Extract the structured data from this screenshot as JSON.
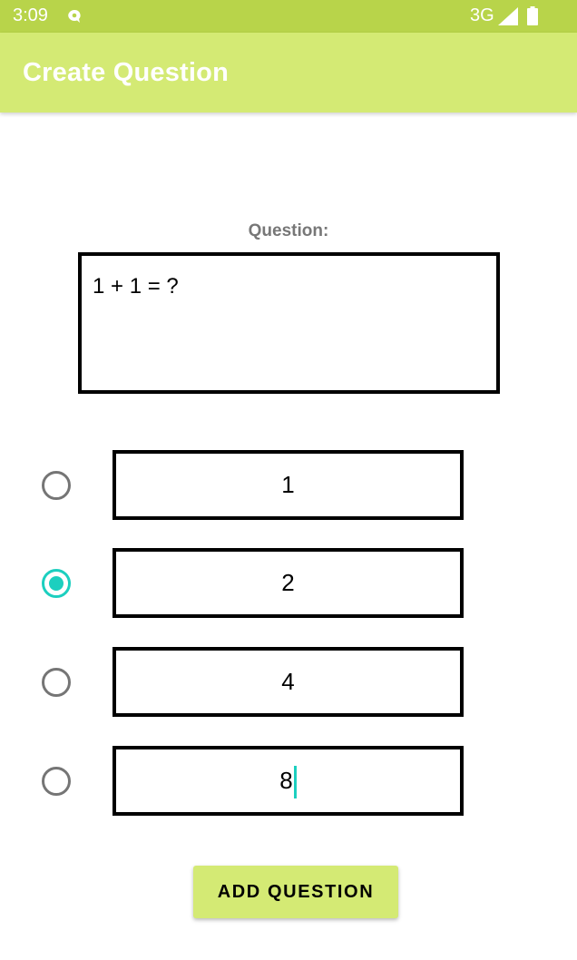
{
  "status_bar": {
    "time": "3:09",
    "notification_icon": "chat-bubble-icon",
    "network": "3G",
    "signal_icon": "signal-icon",
    "battery_icon": "battery-icon"
  },
  "app_bar": {
    "title": "Create Question"
  },
  "question": {
    "label": "Question:",
    "value": "1 + 1 = ?"
  },
  "answers": [
    {
      "value": "1",
      "selected": false
    },
    {
      "value": "2",
      "selected": true
    },
    {
      "value": "4",
      "selected": false
    },
    {
      "value": "8",
      "selected": false,
      "focused": true
    }
  ],
  "actions": {
    "add_question_label": "ADD QUESTION"
  },
  "colors": {
    "status_bar": "#b8d44a",
    "app_bar": "#d4ea74",
    "accent": "#1ccfbf",
    "button": "#d4ea74"
  }
}
